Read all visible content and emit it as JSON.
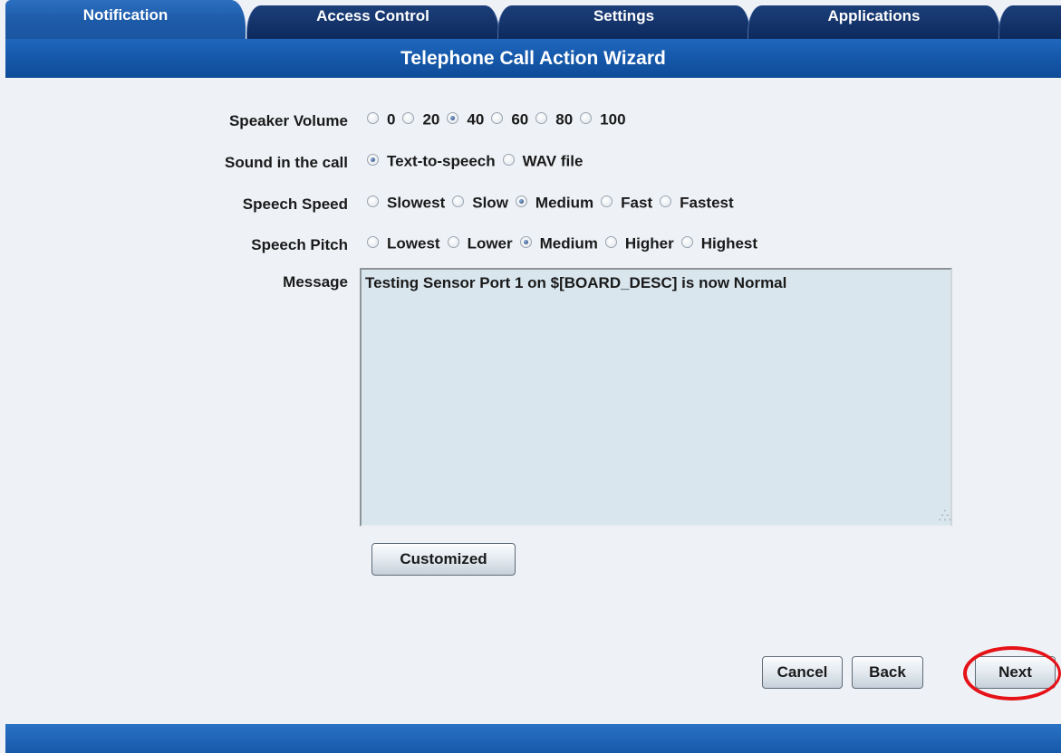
{
  "tabs": [
    {
      "label": "Notification",
      "active": true
    },
    {
      "label": "Access Control",
      "active": false
    },
    {
      "label": "Settings",
      "active": false
    },
    {
      "label": "Applications",
      "active": false
    }
  ],
  "title": "Telephone Call Action Wizard",
  "form": {
    "speaker_volume": {
      "label": "Speaker Volume",
      "options": [
        "0",
        "20",
        "40",
        "60",
        "80",
        "100"
      ],
      "selected": "40"
    },
    "sound": {
      "label": "Sound in the call",
      "options": [
        "Text-to-speech",
        "WAV file"
      ],
      "selected": "Text-to-speech"
    },
    "speech_speed": {
      "label": "Speech Speed",
      "options": [
        "Slowest",
        "Slow",
        "Medium",
        "Fast",
        "Fastest"
      ],
      "selected": "Medium"
    },
    "speech_pitch": {
      "label": "Speech Pitch",
      "options": [
        "Lowest",
        "Lower",
        "Medium",
        "Higher",
        "Highest"
      ],
      "selected": "Medium"
    },
    "message": {
      "label": "Message",
      "value": "Testing Sensor Port 1 on $[BOARD_DESC] is now Normal"
    },
    "customized_label": "Customized"
  },
  "buttons": {
    "cancel": "Cancel",
    "back": "Back",
    "next": "Next"
  },
  "colors": {
    "tab_active": "#1d5aa8",
    "tab_inactive": "#0d2a5c",
    "titlebar": "#1558aa",
    "page_bg": "#eef1f6",
    "message_bg": "#d9e6ee",
    "highlight": "#e51217"
  }
}
